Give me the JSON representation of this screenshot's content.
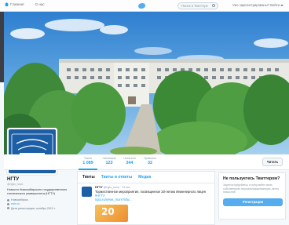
{
  "topnav": {
    "home_label": "Главная",
    "about_label": "О нас",
    "search_placeholder": "Поиск в Твиттере",
    "have_account": "Уже зарегистрированы? Войти"
  },
  "colors": {
    "accent": "#1da1f2",
    "brand_blue": "#1d5fa6",
    "signup_button": "#55acee"
  },
  "stats": [
    {
      "label": "Твиты",
      "value": "1 089"
    },
    {
      "label": "Читаемые",
      "value": "123"
    },
    {
      "label": "Читатели",
      "value": "344"
    },
    {
      "label": "Нравится",
      "value": "32"
    }
  ],
  "read_button": "Читать",
  "profile": {
    "name": "НГТУ",
    "handle": "@ngtu_novo",
    "bio": "Новости Новосибирского государственного технического университета (НГТУ)",
    "location": "Новосибирск",
    "website": "nstu.ru",
    "joined": "Дата регистрации: октябрь 2012 г."
  },
  "timeline": {
    "tabs": [
      "Твиты",
      "Твиты и ответы",
      "Медиа"
    ],
    "tweet": {
      "author": "НГТУ",
      "handle": "@ngtu_novo · 14 окт.",
      "text": "Торжественное мероприятие, посвященное 20-летию Инженерного лицея",
      "hashtag": "#НГТУ",
      "link": "ngtu.ru/news_more?idw...",
      "media_text": "20"
    }
  },
  "signup": {
    "heading": "Не пользуетесь Твиттером?",
    "text": "Зарегистрируйтесь и получайте свою собственную персонализированную ленту новостей!",
    "button": "Регистрация"
  },
  "avatar_text": "НГТУ"
}
